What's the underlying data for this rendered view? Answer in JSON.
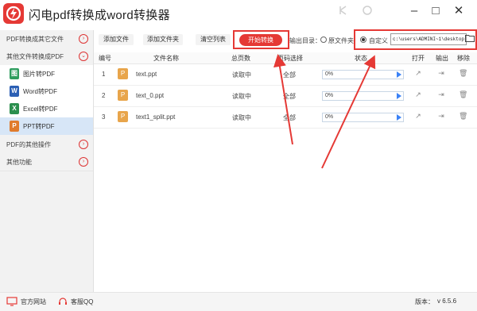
{
  "app": {
    "title": "闪电pdf转换成word转换器"
  },
  "window_controls": [
    "–",
    "□",
    "✕"
  ],
  "sidebar": {
    "sections": [
      {
        "label": "PDF转换成其它文件"
      },
      {
        "label": "其他文件转换成PDF"
      }
    ],
    "items": [
      {
        "label": "图片转PDF",
        "icon": "image-icon",
        "icon_text": "图",
        "color": "#2e9d5e"
      },
      {
        "label": "Word转PDF",
        "icon": "word-icon",
        "icon_text": "W",
        "color": "#2b5fb4"
      },
      {
        "label": "Excel转PDF",
        "icon": "excel-icon",
        "icon_text": "X",
        "color": "#2b8f4e"
      },
      {
        "label": "PPT转PDF",
        "icon": "ppt-icon",
        "icon_text": "P",
        "color": "#e07b2d"
      }
    ],
    "bottom_sections": [
      {
        "label": "PDF的其他操作"
      },
      {
        "label": "其他功能"
      }
    ]
  },
  "toolbar": {
    "add_file": "添加文件",
    "add_folder": "添加文件夹",
    "clear_list": "清空列表",
    "start": "开始转换",
    "output_dir_label": "输出目录：",
    "original_folder": "原文件夹",
    "custom": "自定义",
    "path": "c:\\users\\ADMINI~1\\desktop"
  },
  "table": {
    "headers": [
      "编号",
      "文件名称",
      "总页数",
      "页码选择",
      "状态",
      "打开",
      "输出",
      "移除"
    ],
    "rows": [
      {
        "no": "1",
        "name": "text.ppt",
        "pages": "读取中",
        "range": "全部",
        "progress": "0%"
      },
      {
        "no": "2",
        "name": "text_0.ppt",
        "pages": "读取中",
        "range": "全部",
        "progress": "0%"
      },
      {
        "no": "3",
        "name": "text1_split.ppt",
        "pages": "读取中",
        "range": "全部",
        "progress": "0%"
      }
    ]
  },
  "footer": {
    "website": "官方网站",
    "qq": "客服QQ",
    "version_label": "版本：",
    "version": "v 6.5.6"
  },
  "colors": {
    "accent": "#e53935",
    "file_icon": "#e8a54b",
    "progress_play": "#3b82f6"
  }
}
